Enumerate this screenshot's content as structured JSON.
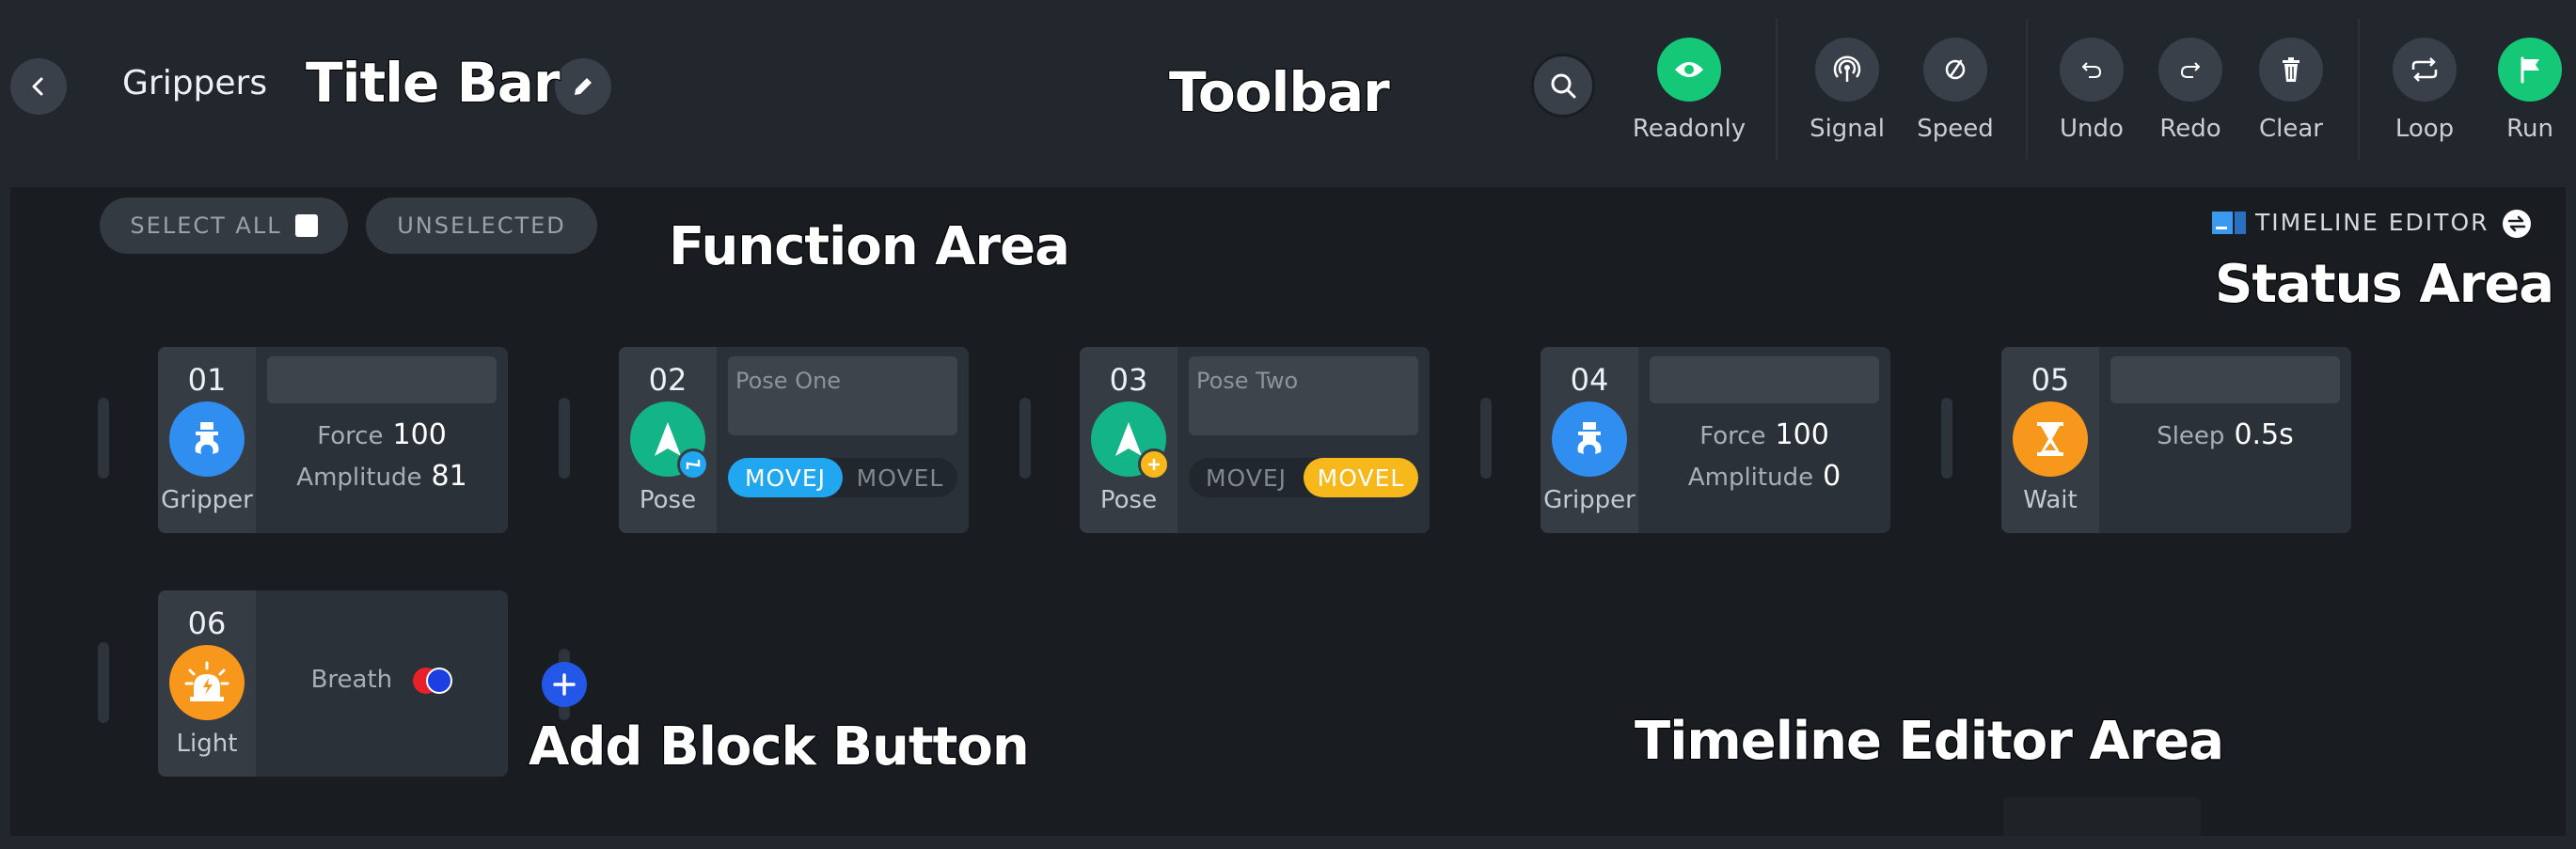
{
  "titlebar": {
    "title": "Grippers"
  },
  "toolbar": {
    "items": [
      {
        "label": "Readonly",
        "icon": "eye-icon"
      },
      {
        "label": "Signal",
        "icon": "signal-icon"
      },
      {
        "label": "Speed",
        "icon": "speed-icon"
      },
      {
        "label": "Undo",
        "icon": "undo-icon"
      },
      {
        "label": "Redo",
        "icon": "redo-icon"
      },
      {
        "label": "Clear",
        "icon": "trash-icon"
      },
      {
        "label": "Loop",
        "icon": "loop-icon"
      },
      {
        "label": "Run",
        "icon": "flag-icon"
      }
    ]
  },
  "function_area": {
    "select_all": "SELECT ALL",
    "unselected": "UNSELECTED"
  },
  "status_area": {
    "label": "TIMELINE EDITOR"
  },
  "blocks": [
    {
      "num": "01",
      "type": "Gripper",
      "rows": [
        {
          "k": "Force",
          "v": "100"
        },
        {
          "k": "Amplitude",
          "v": "81"
        }
      ]
    },
    {
      "num": "02",
      "type": "Pose",
      "name": "Pose One",
      "movej": "MOVEJ",
      "movel": "MOVEL",
      "active": "MOVEJ"
    },
    {
      "num": "03",
      "type": "Pose",
      "name": "Pose Two",
      "movej": "MOVEJ",
      "movel": "MOVEL",
      "active": "MOVEL"
    },
    {
      "num": "04",
      "type": "Gripper",
      "rows": [
        {
          "k": "Force",
          "v": "100"
        },
        {
          "k": "Amplitude",
          "v": "0"
        }
      ]
    },
    {
      "num": "05",
      "type": "Wait",
      "rows": [
        {
          "k": "Sleep",
          "v": "0.5s"
        }
      ]
    },
    {
      "num": "06",
      "type": "Light",
      "rows": [
        {
          "k": "Breath",
          "v": ""
        }
      ]
    }
  ],
  "annotations": {
    "title_bar": "Title Bar",
    "toolbar": "Toolbar",
    "function_area": "Function Area",
    "status_area": "Status Area",
    "add_block_button": "Add Block Button",
    "timeline_editor_area": "Timeline Editor Area"
  },
  "colors": {
    "background": "#22272d",
    "editor_bg": "#191d21",
    "run_green": "#15c878",
    "movej_blue": "#21a7f0",
    "movel_yellow": "#f6b81a",
    "add_blue": "#2357e8"
  }
}
